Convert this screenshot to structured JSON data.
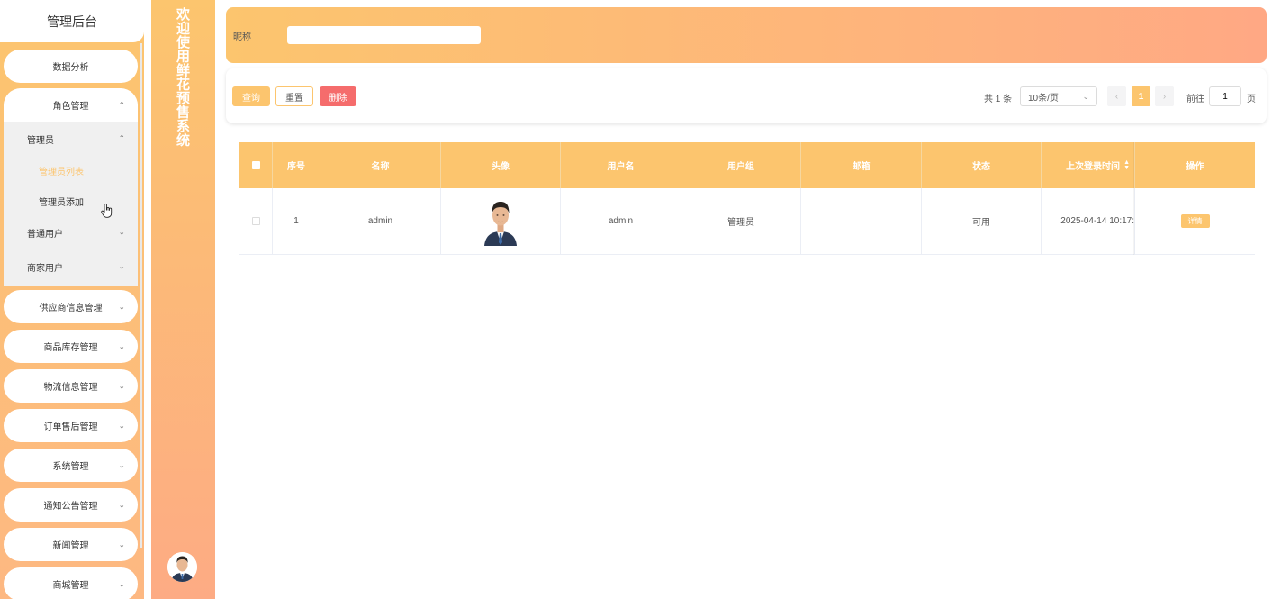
{
  "sidebar": {
    "title": "管理后台",
    "items": [
      {
        "label": "数据分析"
      },
      {
        "label": "角色管理"
      },
      {
        "label": "供应商信息管理"
      },
      {
        "label": "商品库存管理"
      },
      {
        "label": "物流信息管理"
      },
      {
        "label": "订单售后管理"
      },
      {
        "label": "系统管理"
      },
      {
        "label": "通知公告管理"
      },
      {
        "label": "新闻管理"
      },
      {
        "label": "商城管理"
      }
    ],
    "role_sub": {
      "admin_label": "管理员",
      "admin_list": "管理员列表",
      "admin_add": "管理员添加",
      "normal_user": "普通用户",
      "merchant_user": "商家用户"
    }
  },
  "welcome": {
    "text": "欢迎使用鲜花预售系统"
  },
  "search": {
    "label": "昵称",
    "value": "",
    "placeholder": ""
  },
  "toolbar": {
    "query_label": "查询",
    "reset_label": "重置",
    "delete_label": "删除"
  },
  "pagination": {
    "total": "共 1 条",
    "page_size": "10条/页",
    "current_page": "1",
    "goto_label": "前往",
    "goto_value": "1",
    "page_suffix": "页"
  },
  "table": {
    "headers": [
      "序号",
      "名称",
      "头像",
      "用户名",
      "用户组",
      "邮箱",
      "状态",
      "上次登录时间",
      "操作"
    ],
    "rows": [
      {
        "index": "1",
        "name": "admin",
        "username": "admin",
        "group": "管理员",
        "email": "",
        "status": "可用",
        "last_login": "2025-04-14 10:17:",
        "action": "详情"
      }
    ]
  },
  "colors": {
    "accent": "#fcc56e",
    "accent_end": "#ffa884",
    "danger": "#f56c6c"
  }
}
